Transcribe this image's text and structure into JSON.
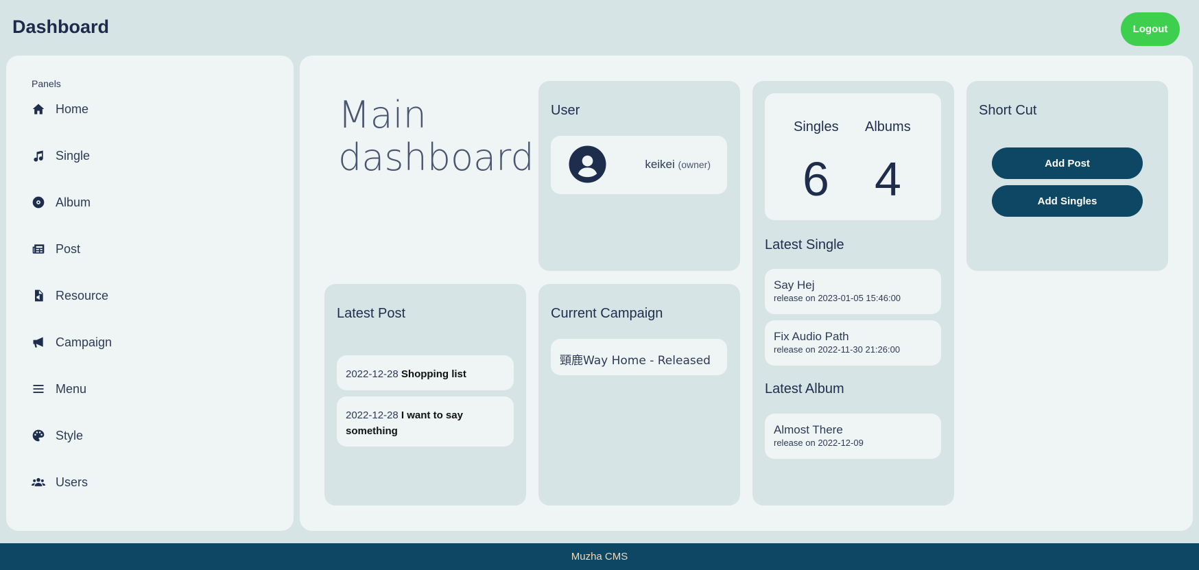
{
  "header": {
    "title": "Dashboard",
    "logout_label": "Logout"
  },
  "sidebar": {
    "section_label": "Panels",
    "items": [
      {
        "label": "Home",
        "icon": "home-icon"
      },
      {
        "label": "Single",
        "icon": "music-note-icon"
      },
      {
        "label": "Album",
        "icon": "disc-icon"
      },
      {
        "label": "Post",
        "icon": "newspaper-icon"
      },
      {
        "label": "Resource",
        "icon": "audio-file-icon"
      },
      {
        "label": "Campaign",
        "icon": "megaphone-icon"
      },
      {
        "label": "Menu",
        "icon": "menu-lines-icon"
      },
      {
        "label": "Style",
        "icon": "palette-icon"
      },
      {
        "label": "Users",
        "icon": "users-icon"
      }
    ]
  },
  "main": {
    "heading": "Main dashboard",
    "user_card": {
      "title": "User",
      "name": "keikei",
      "role": "(owner)"
    },
    "stats": {
      "singles_label": "Singles",
      "singles_count": "6",
      "albums_label": "Albums",
      "albums_count": "4"
    },
    "latest_single": {
      "title": "Latest Single",
      "items": [
        {
          "name": "Say Hej",
          "release": "release on 2023-01-05 15:46:00"
        },
        {
          "name": "Fix Audio Path",
          "release": "release on 2022-11-30 21:26:00"
        }
      ]
    },
    "latest_album": {
      "title": "Latest Album",
      "items": [
        {
          "name": "Almost There",
          "release": "release on 2022-12-09"
        }
      ]
    },
    "shortcut": {
      "title": "Short Cut",
      "add_post_label": "Add Post",
      "add_singles_label": "Add Singles"
    },
    "latest_post": {
      "title": "Latest Post",
      "items": [
        {
          "date": "2022-12-28",
          "title": "Shopping list"
        },
        {
          "date": "2022-12-28",
          "title": "I want to say something"
        }
      ]
    },
    "campaign": {
      "title": "Current Campaign",
      "item": "頸鹿Way Home - Released"
    }
  },
  "footer": {
    "text": "Muzha CMS"
  },
  "colors": {
    "background": "#d6e4e6",
    "panel": "#eff5f5",
    "primary": "#0d4763",
    "logout": "#3ecf4e",
    "text": "#1f2d4d"
  }
}
